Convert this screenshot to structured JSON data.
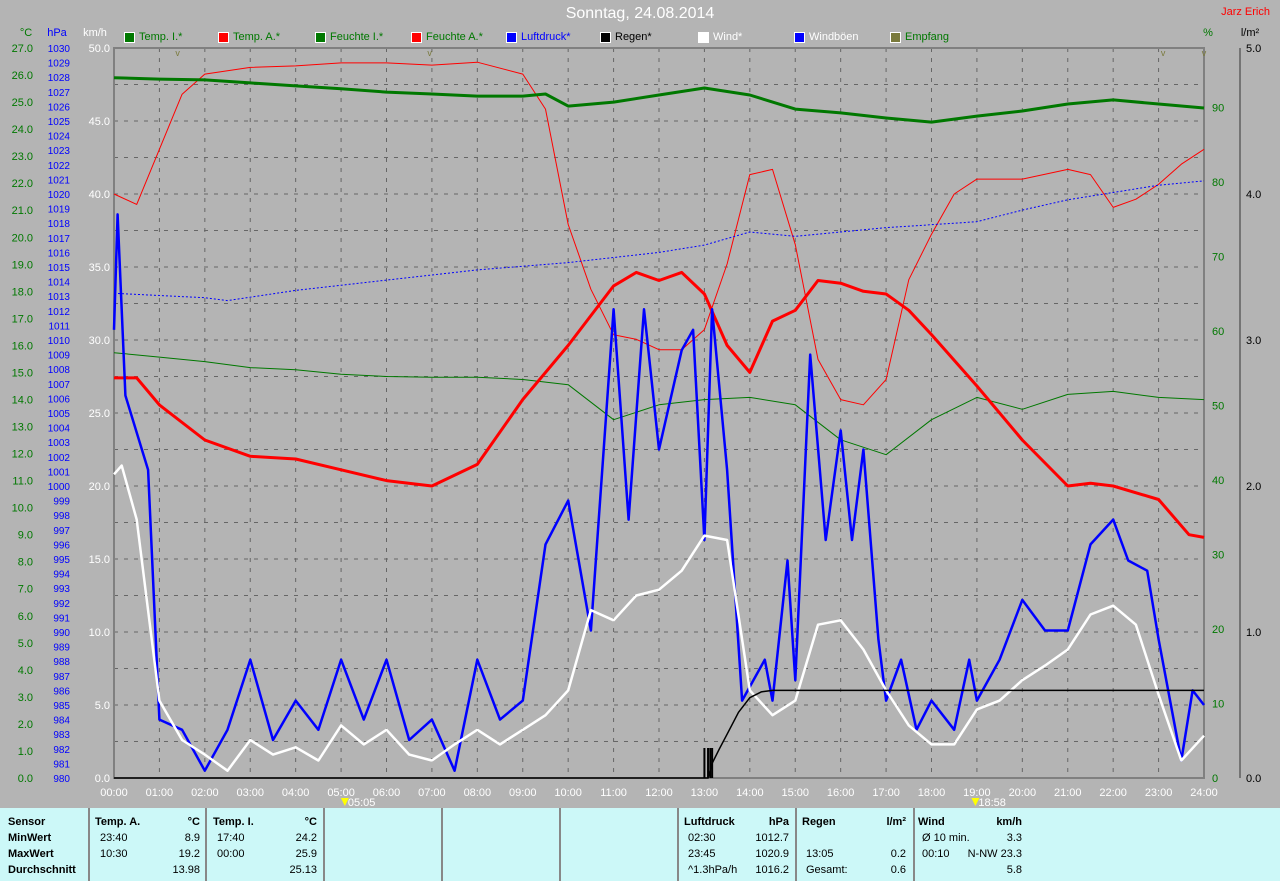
{
  "title": "Sonntag, 24.08.2014",
  "author": "Jarz Erich",
  "legend": [
    {
      "label": "Temp. I.*",
      "color": "#007800",
      "text": "#007800"
    },
    {
      "label": "Temp. A.*",
      "color": "#ff0000",
      "text": "#007800"
    },
    {
      "label": "Feuchte I.*",
      "color": "#007800",
      "text": "#007800"
    },
    {
      "label": "Feuchte A.*",
      "color": "#ff0000",
      "text": "#007800"
    },
    {
      "label": "Luftdruck*",
      "color": "#0000ff",
      "text": "#0000ff"
    },
    {
      "label": "Regen*",
      "color": "#000000",
      "text": "#000000"
    },
    {
      "label": "Wind*",
      "color": "#ffffff",
      "text": "#ffffff"
    },
    {
      "label": "Windböen",
      "color": "#0000ff",
      "text": "#ffffff"
    },
    {
      "label": "Empfang",
      "color": "#7a7a3c",
      "text": "#007800"
    }
  ],
  "markers": {
    "sunrise": "05:05",
    "sunset": "18:58"
  },
  "chart_data": {
    "type": "line",
    "title": "Sonntag, 24.08.2014",
    "xlabel": "",
    "x_range": [
      0,
      24
    ],
    "x_ticks": [
      "00:00",
      "01:00",
      "02:00",
      "03:00",
      "04:00",
      "05:00",
      "06:00",
      "07:00",
      "08:00",
      "09:00",
      "10:00",
      "11:00",
      "12:00",
      "13:00",
      "14:00",
      "15:00",
      "16:00",
      "17:00",
      "18:00",
      "19:00",
      "20:00",
      "21:00",
      "22:00",
      "23:00",
      "24:00"
    ],
    "axes": {
      "temp": {
        "label": "°C",
        "range": [
          0,
          27
        ],
        "step": 1,
        "color": "#007800"
      },
      "press": {
        "label": "hPa",
        "range": [
          980,
          1030
        ],
        "step": 1,
        "color": "#0000ff"
      },
      "wind": {
        "label": "km/h",
        "range": [
          0,
          50
        ],
        "step": 5,
        "color": "#ffffff"
      },
      "hum": {
        "label": "%",
        "range": [
          0,
          98
        ],
        "step": 10,
        "color": "#007800"
      },
      "rain": {
        "label": "l/m²",
        "range": [
          0,
          5
        ],
        "step": 1,
        "color": "#000000"
      }
    },
    "grid": true,
    "series": [
      {
        "name": "Feuchte I.*",
        "axis": "hum",
        "color": "#007800",
        "width": 1,
        "x": [
          0,
          1,
          2,
          3,
          4,
          5,
          6,
          7,
          8,
          9,
          10,
          11,
          12,
          13,
          14,
          15,
          16,
          17,
          18,
          19,
          20,
          21,
          22,
          23,
          24
        ],
        "y": [
          57.1,
          56.5,
          55.9,
          55.1,
          54.8,
          54.2,
          53.9,
          53.8,
          53.8,
          53.5,
          52.8,
          48.1,
          50.1,
          50.8,
          51.1,
          50.1,
          45.4,
          43.4,
          48.1,
          51.1,
          49.5,
          51.5,
          51.9,
          51.1,
          50.8
        ]
      },
      {
        "name": "Feuchte A.*",
        "axis": "hum",
        "color": "#ff0000",
        "width": 1,
        "x": [
          0,
          0.5,
          1,
          1.5,
          2,
          3,
          4,
          5,
          6,
          7,
          8,
          9,
          9.5,
          10,
          10.5,
          11,
          11.5,
          12,
          12.5,
          13,
          13.5,
          14,
          14.5,
          15,
          15.5,
          16,
          16.5,
          17,
          17.5,
          18,
          18.5,
          19,
          20,
          21,
          21.5,
          22,
          22.5,
          23,
          23.5,
          24
        ],
        "y": [
          78.4,
          77.0,
          84.4,
          91.8,
          94.5,
          95.4,
          95.6,
          96.0,
          96.0,
          95.7,
          96.1,
          94.5,
          89.8,
          74.3,
          65.6,
          59.5,
          58.9,
          57.5,
          57.5,
          60.2,
          69.0,
          81.0,
          81.7,
          71.6,
          56.2,
          50.8,
          50.1,
          53.5,
          66.9,
          73.0,
          78.4,
          80.4,
          80.4,
          81.7,
          81.0,
          76.6,
          77.7,
          79.7,
          82.4,
          84.4
        ]
      },
      {
        "name": "Luftdruck*",
        "axis": "press",
        "color": "#0000ff",
        "width": 1,
        "dash": "2,2",
        "x": [
          0,
          2,
          2.5,
          4,
          6,
          8,
          10,
          12,
          13,
          14,
          15,
          16,
          17,
          18,
          19,
          20,
          21,
          22,
          23,
          24
        ],
        "y": [
          1013.2,
          1012.9,
          1012.7,
          1013.4,
          1014.1,
          1014.8,
          1015.3,
          1016.0,
          1016.5,
          1017.4,
          1017.1,
          1017.4,
          1017.7,
          1017.9,
          1018.1,
          1018.9,
          1019.6,
          1020.1,
          1020.6,
          1020.9
        ]
      },
      {
        "name": "Temp. I.*",
        "axis": "temp",
        "color": "#007800",
        "width": 3,
        "x": [
          0,
          1,
          2,
          3,
          4,
          5,
          6,
          7,
          8,
          9,
          9.5,
          10,
          11,
          12,
          13,
          14,
          15,
          16,
          17,
          18,
          19,
          20,
          21,
          22,
          23,
          24
        ],
        "y": [
          25.9,
          25.85,
          25.82,
          25.71,
          25.6,
          25.49,
          25.37,
          25.3,
          25.22,
          25.22,
          25.3,
          24.85,
          25.0,
          25.26,
          25.52,
          25.26,
          24.74,
          24.6,
          24.41,
          24.26,
          24.48,
          24.67,
          24.93,
          25.08,
          24.93,
          24.78
        ]
      },
      {
        "name": "Temp. A.*",
        "axis": "temp",
        "color": "#ff0000",
        "width": 3,
        "x": [
          0,
          0.5,
          1,
          2,
          3,
          4,
          5,
          6,
          7,
          8,
          9,
          10,
          11,
          11.5,
          12,
          12.5,
          13,
          13.5,
          14,
          14.5,
          15,
          15.5,
          16,
          16.5,
          17,
          17.5,
          18,
          19,
          20,
          21,
          21.5,
          22,
          23,
          23.67,
          24
        ],
        "y": [
          14.8,
          14.8,
          13.8,
          12.5,
          11.9,
          11.8,
          11.4,
          11.0,
          10.8,
          11.6,
          14.0,
          16.0,
          18.2,
          18.7,
          18.4,
          18.7,
          17.9,
          16.0,
          15.0,
          16.9,
          17.3,
          18.4,
          18.3,
          18.0,
          17.9,
          17.3,
          16.4,
          14.5,
          12.5,
          10.8,
          10.9,
          10.8,
          10.3,
          9.0,
          8.9
        ]
      },
      {
        "name": "Windböen",
        "axis": "wind",
        "color": "#0000ff",
        "width": 2.5,
        "x": [
          0,
          0.08,
          0.25,
          0.75,
          1,
          1.5,
          2,
          2.5,
          3,
          3.5,
          4,
          4.5,
          5,
          5.5,
          6,
          6.5,
          7,
          7.5,
          8,
          8.5,
          9,
          9.5,
          10,
          10.5,
          11,
          11.33,
          11.67,
          12,
          12.5,
          12.75,
          13,
          13.17,
          13.5,
          13.83,
          14.33,
          14.5,
          14.83,
          15,
          15.33,
          15.67,
          16,
          16.25,
          16.5,
          16.83,
          17,
          17.33,
          17.67,
          18,
          18.5,
          18.83,
          19,
          19.5,
          20,
          20.5,
          21,
          21.5,
          22,
          22.33,
          22.75,
          23,
          23.5,
          23.75,
          24
        ],
        "y": [
          30.7,
          38.6,
          26.2,
          21.1,
          4.0,
          3.3,
          0.5,
          3.3,
          8.1,
          2.6,
          5.3,
          3.3,
          8.1,
          4.0,
          8.1,
          2.6,
          4.0,
          0.5,
          8.1,
          4.0,
          5.3,
          16.0,
          19.0,
          10.1,
          32.1,
          17.7,
          32.1,
          22.5,
          29.3,
          30.7,
          16.3,
          32.1,
          21.1,
          5.3,
          8.1,
          5.3,
          14.9,
          6.7,
          29.0,
          16.3,
          23.8,
          16.3,
          22.5,
          9.5,
          5.3,
          8.1,
          3.3,
          5.3,
          3.3,
          8.1,
          5.3,
          8.1,
          12.2,
          10.1,
          10.1,
          16.0,
          17.7,
          14.9,
          14.2,
          9.5,
          1.2,
          6.0,
          5.0
        ]
      },
      {
        "name": "Wind*",
        "axis": "wind",
        "color": "#ffffff",
        "width": 2.5,
        "x": [
          0,
          0.17,
          0.5,
          1,
          1.5,
          2,
          2.5,
          3,
          3.5,
          4,
          4.5,
          5,
          5.5,
          6,
          6.5,
          7,
          7.5,
          8,
          8.5,
          9,
          9.5,
          10,
          10.5,
          11,
          11.5,
          12,
          12.5,
          13,
          13.5,
          14,
          14.5,
          15,
          15.5,
          16,
          16.5,
          17,
          17.5,
          18,
          18.5,
          19,
          19.5,
          20,
          20.5,
          21,
          21.5,
          22,
          22.5,
          23,
          23.5,
          24
        ],
        "y": [
          20.8,
          21.4,
          17.7,
          5.3,
          2.6,
          1.6,
          0.5,
          2.6,
          1.6,
          2.1,
          1.2,
          3.6,
          2.3,
          3.3,
          1.6,
          1.2,
          2.3,
          3.3,
          2.3,
          3.3,
          4.3,
          6.0,
          11.5,
          10.8,
          12.5,
          12.9,
          14.2,
          16.6,
          16.3,
          6.0,
          4.3,
          5.3,
          10.5,
          10.8,
          8.8,
          6.0,
          3.6,
          2.3,
          2.3,
          4.7,
          5.3,
          6.7,
          7.7,
          8.8,
          11.2,
          11.8,
          10.5,
          5.7,
          1.2,
          2.9
        ]
      },
      {
        "name": "Regen*",
        "axis": "rain",
        "color": "#000000",
        "width": 1.5,
        "x": [
          0,
          13.08,
          13.17,
          13.33,
          13.5,
          13.75,
          14,
          14.25,
          14.5,
          24
        ],
        "y": [
          0,
          0,
          0.1,
          0.2,
          0.3,
          0.45,
          0.55,
          0.59,
          0.6,
          0.6
        ]
      }
    ]
  },
  "table": {
    "temp_a": {
      "header": [
        "Sensor",
        "Temp. A.",
        "°C"
      ],
      "rows": [
        [
          "MinWert",
          "23:40",
          "8.9"
        ],
        [
          "MaxWert",
          "10:30",
          "19.2"
        ],
        [
          "Durchschnitt",
          "",
          "13.98"
        ]
      ]
    },
    "temp_i": {
      "header": [
        "Temp. I.",
        "°C"
      ],
      "rows": [
        [
          "17:40",
          "24.2"
        ],
        [
          "00:00",
          "25.9"
        ],
        [
          "",
          "25.13"
        ]
      ]
    },
    "press": {
      "header": [
        "Luftdruck",
        "hPa"
      ],
      "rows": [
        [
          "02:30",
          "1012.7"
        ],
        [
          "23:45",
          "1020.9"
        ],
        [
          "^1.3hPa/h",
          "1016.2"
        ]
      ]
    },
    "rain": {
      "header": [
        "Regen",
        "l/m²"
      ],
      "rows": [
        [
          "",
          ""
        ],
        [
          "13:05",
          "0.2"
        ],
        [
          "Gesamt:",
          "0.6"
        ]
      ]
    },
    "wind": {
      "header": [
        "Wind",
        "km/h"
      ],
      "rows": [
        [
          "Ø 10 min.",
          "3.3"
        ],
        [
          "00:10",
          "N-NW 23.3"
        ],
        [
          "",
          "5.8"
        ]
      ]
    }
  }
}
